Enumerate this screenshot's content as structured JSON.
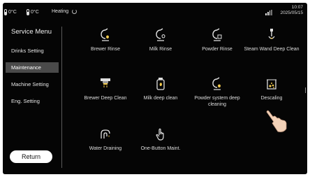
{
  "status": {
    "temp1": "0°C",
    "temp2": "0°C",
    "heating_label": "Heating",
    "time": "10:07",
    "date": "2025/05/15"
  },
  "sidebar": {
    "title": "Service Menu",
    "items": [
      {
        "label": "Drinks Setting"
      },
      {
        "label": "Maintenance"
      },
      {
        "label": "Machine Setting"
      },
      {
        "label": "Eng. Setting"
      }
    ],
    "return_label": "Return"
  },
  "tiles": [
    {
      "label": "Brewer Rinse",
      "icon": "brewer-rinse-icon"
    },
    {
      "label": "Milk Rinse",
      "icon": "milk-rinse-icon"
    },
    {
      "label": "Powder Rinse",
      "icon": "powder-rinse-icon"
    },
    {
      "label": "Steam Wand Deep Clean",
      "icon": "steam-wand-icon"
    },
    {
      "label": "Brewer Deep Clean",
      "icon": "brewer-deep-clean-icon"
    },
    {
      "label": "Milk deep clean",
      "icon": "milk-deep-clean-icon"
    },
    {
      "label": "Powder system deep cleaning",
      "icon": "powder-deep-clean-icon"
    },
    {
      "label": "Descaling",
      "icon": "descaling-icon"
    },
    {
      "label": "Water Draining",
      "icon": "water-draining-icon"
    },
    {
      "label": "One-Button Maint.",
      "icon": "touch-hand-icon"
    }
  ],
  "colors": {
    "background": "#050505",
    "text": "#e6e6e6",
    "active_item": "#4a4a4a",
    "icon_accent": "#f2c94c"
  }
}
